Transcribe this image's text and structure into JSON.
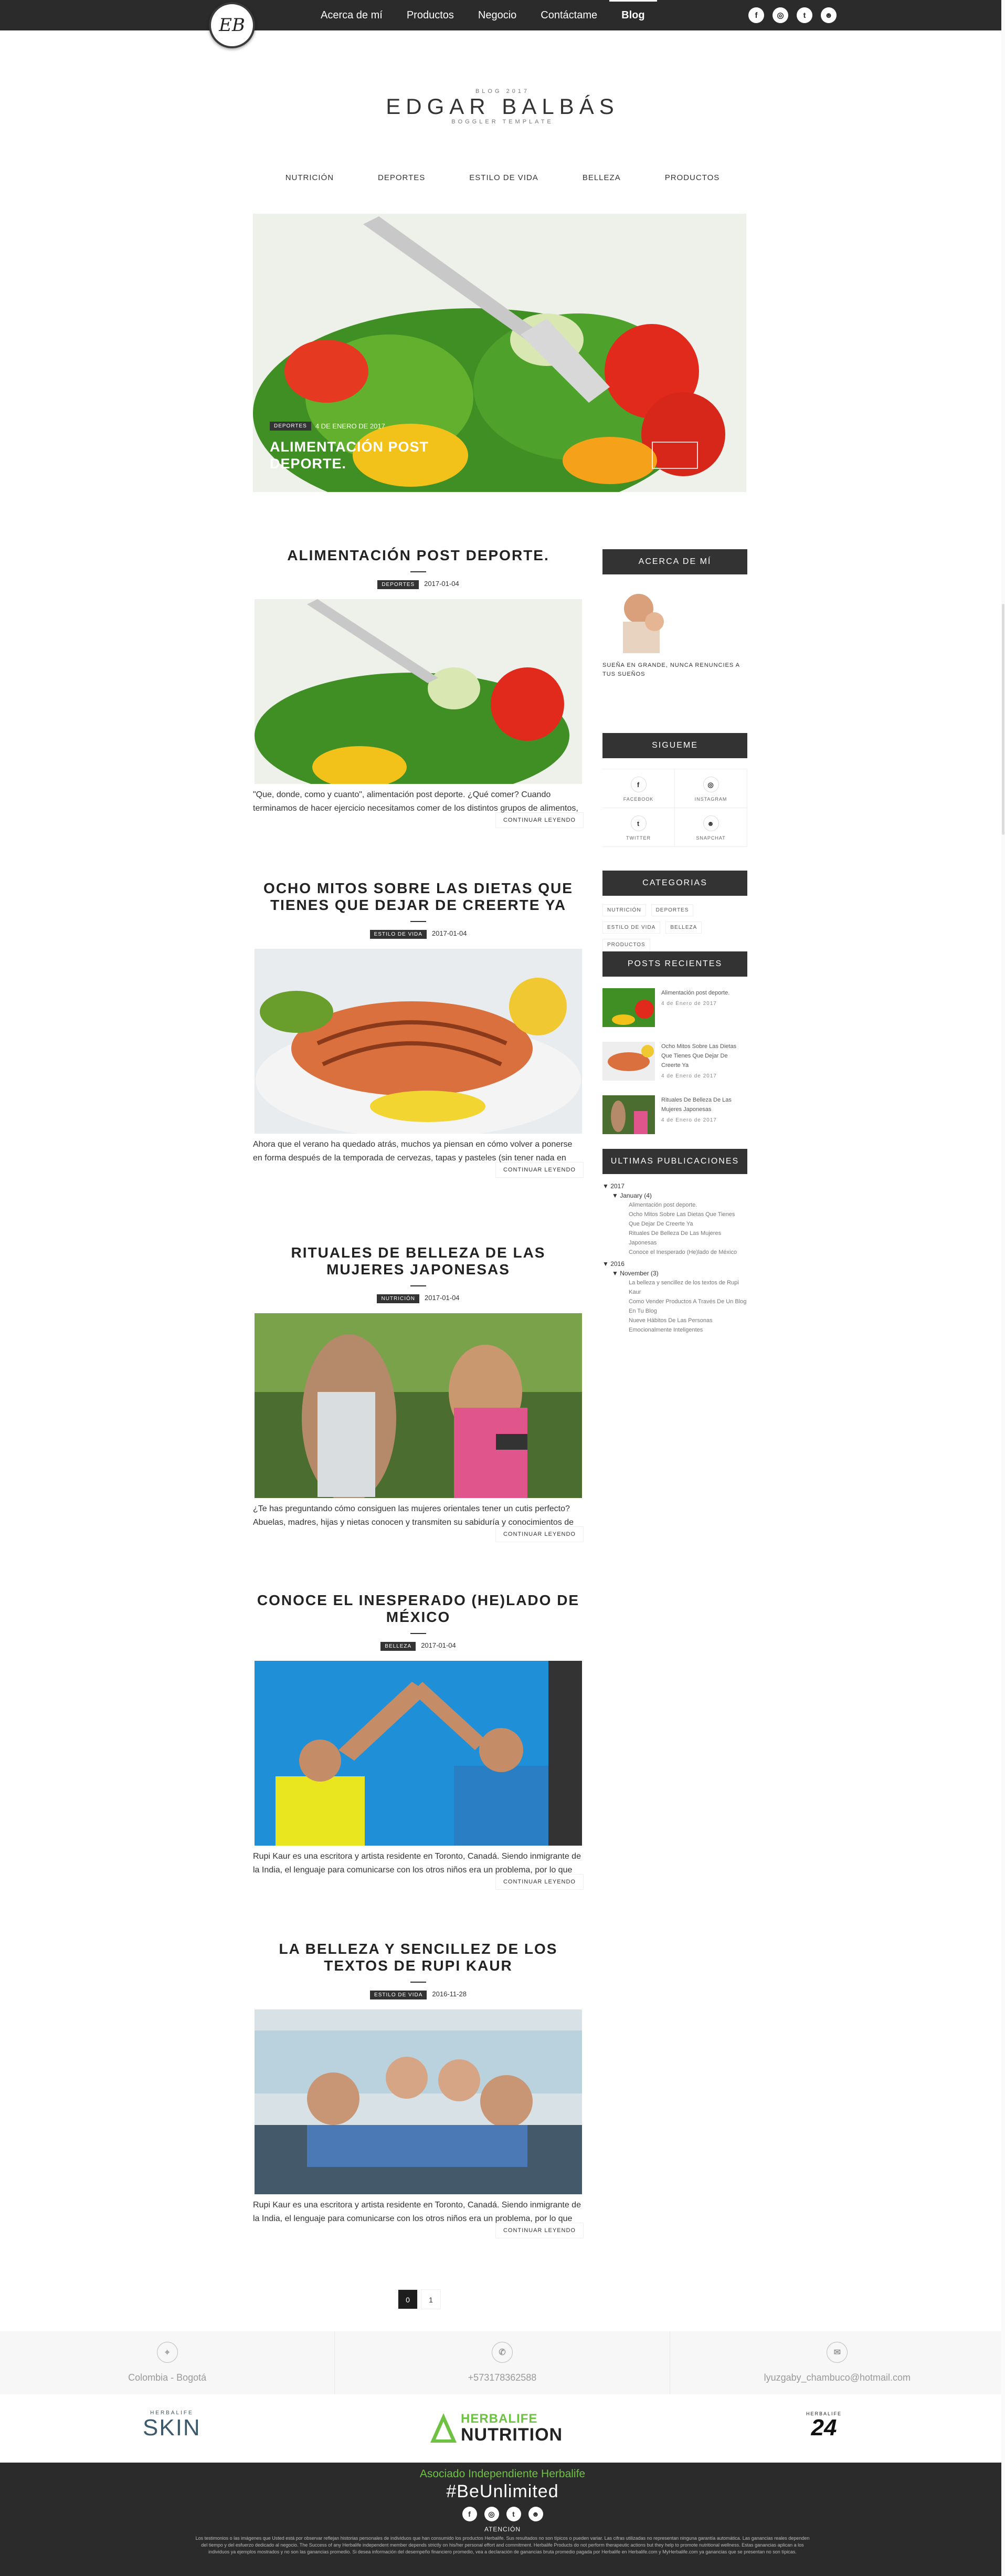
{
  "logo": {
    "initials": "EB"
  },
  "nav": [
    {
      "label": "Acerca de mí",
      "active": false
    },
    {
      "label": "Productos",
      "active": false
    },
    {
      "label": "Negocio",
      "active": false
    },
    {
      "label": "Contáctame",
      "active": false
    },
    {
      "label": "Blog",
      "active": true
    }
  ],
  "social_top": [
    "f",
    "◎",
    "t",
    "☻"
  ],
  "brand": {
    "kicker": "BLOG 2017",
    "name": "EDGAR BALBÁS",
    "sub": "BOGGLER TEMPLATE"
  },
  "categories_nav": [
    "NUTRICIÓN",
    "DEPORTES",
    "ESTILO DE VIDA",
    "BELLEZA",
    "PRODUCTOS"
  ],
  "hero": {
    "tag": "DEPORTES",
    "date": "4 DE ENERO DE 2017",
    "title": "ALIMENTACIÓN POST DEPORTE."
  },
  "posts": [
    {
      "title": "ALIMENTACIÓN POST DEPORTE.",
      "tag": "DEPORTES",
      "date": "2017-01-04",
      "excerpt": "\"Que, donde, como y cuanto\", alimentación post deporte. ¿Qué comer? Cuando terminamos de hacer ejercicio necesitamos comer de los distintos grupos de alimentos, prestando espec...",
      "more": "CONTINUAR LEYENDO"
    },
    {
      "title": "OCHO MITOS SOBRE LAS DIETAS QUE TIENES QUE DEJAR DE CREERTE YA",
      "tag": "ESTILO DE VIDA",
      "date": "2017-01-04",
      "excerpt": "Ahora que el verano ha quedado atrás, muchos ya piensan en cómo volver a ponerse en forma después de la temporada de cervezas, tapas y pasteles (sin tener nada en contra d...",
      "more": "CONTINUAR LEYENDO"
    },
    {
      "title": "RITUALES DE BELLEZA DE LAS MUJERES JAPONESAS",
      "tag": "NUTRICIÓN",
      "date": "2017-01-04",
      "excerpt": "¿Te has preguntando cómo consiguen las mujeres orientales tener un cutis perfecto? Abuelas, madres, hijas y nietas conocen y transmiten su sabiduría y conocimientos de belleza de...",
      "more": "CONTINUAR LEYENDO"
    },
    {
      "title": "CONOCE EL INESPERADO (HE)LADO DE MÉXICO",
      "tag": "BELLEZA",
      "date": "2017-01-04",
      "excerpt": "Rupi Kaur es una escritora y artista residente en Toronto, Canadá. Siendo inmigrante de la India, el lenguaje para comunicarse con los otros niños era un problema, por lo que pasaba...",
      "more": "CONTINUAR LEYENDO"
    },
    {
      "title": "LA BELLEZA Y SENCILLEZ DE LOS TEXTOS DE RUPI KAUR",
      "tag": "ESTILO DE VIDA",
      "date": "2016-11-28",
      "excerpt": "Rupi Kaur es una escritora y artista residente en Toronto, Canadá. Siendo inmigrante de la India, el lenguaje para comunicarse con los otros niños era un problema, por lo que pasaba...",
      "more": "CONTINUAR LEYENDO"
    }
  ],
  "sidebar": {
    "about_title": "ACERCA DE MÍ",
    "about_text": "SUEÑA EN GRANDE, NUNCA RENUNCIES A TUS SUEÑOS",
    "follow_title": "SIGUEME",
    "follow": [
      {
        "icon": "f",
        "label": "FACEBOOK"
      },
      {
        "icon": "◎",
        "label": "INSTAGRAM"
      },
      {
        "icon": "t",
        "label": "TWITTER"
      },
      {
        "icon": "☻",
        "label": "SNAPCHAT"
      }
    ],
    "cats_title": "CATEGORIAS",
    "cats": [
      "NUTRICIÓN",
      "DEPORTES",
      "ESTILO DE VIDA",
      "BELLEZA",
      "PRODUCTOS"
    ],
    "recent_title": "POSTS RECIENTES",
    "recent": [
      {
        "title": "Alimentación post deporte.",
        "date": "4 de Enero de 2017"
      },
      {
        "title": "Ocho Mitos Sobre Las Dietas Que Tienes Que Dejar De Creerte Ya",
        "date": "4 de Enero de 2017"
      },
      {
        "title": "Rituales De Belleza De Las Mujeres Japonesas",
        "date": "4 de Enero de 2017"
      }
    ],
    "archive_title": "ULTIMAS PUBLICACIONES",
    "archive": {
      "y1": "▼ 2017",
      "m1": "▼ January (4)",
      "p1": [
        "Alimentación post deporte.",
        "Ocho Mitos Sobre Las Dietas Que Tienes Que Dejar De Creerte Ya",
        "Rituales De Belleza De Las Mujeres Japonesas",
        "Conoce el Inesperado (He)lado de México"
      ],
      "y2": "▼ 2016",
      "m2": "▼ November (3)",
      "p2": [
        "La belleza y sencillez de los textos de Rupi Kaur",
        "Como Vender Productos A Través De Un Blog En Tu Blog",
        "Nueve Hábitos De Las Personas Emocionalmente Inteligentes"
      ]
    }
  },
  "pager": [
    "0",
    "1"
  ],
  "contact": {
    "location": "Colombia - Bogotá",
    "phone": "+573178362588",
    "email": "lyuzgaby_chambuco@hotmail.com"
  },
  "brands": {
    "skin_small": "HERBALIFE",
    "skin": "SKIN",
    "nutrition_top": "HERBALIFE",
    "nutrition": "NUTRITION",
    "h24_small": "HERBALIFE",
    "h24": "24"
  },
  "footer": {
    "associate": "Asociado Independiente Herbalife",
    "hashtag": "#BeUnlimited",
    "attention": "ATENCIÓN",
    "legal": "Los testimonios o las imágenes que Usted está por observar reflejan historias personales de individuos que han consumido los productos Herbalife. Sus resultados no son típicos o pueden variar. Las cifras utilizadas no representan ninguna garantía automática. Las ganancias reales dependen del tiempo y del esfuerzo dedicado al negocio. The Success of any Herbalife independent member depends strictly on his/her personal effort and commitment. Herbalife Products do not perform therapeutic actions but they help to promote nutritional wellness. Estas ganancias aplican a los individuos ya ejemplos mostrados y no son las ganancias promedio. Si desea información del desempeño financiero promedio, vea a declaración de ganancias bruta promedio pagada por Herbalife en Herbalife.com y MyHerbalife.com ya ganancias que se presentan no son típicas."
  },
  "colors": {
    "dark": "#2b2b2b",
    "accent_green": "#6ec243",
    "tag": "#333333"
  }
}
